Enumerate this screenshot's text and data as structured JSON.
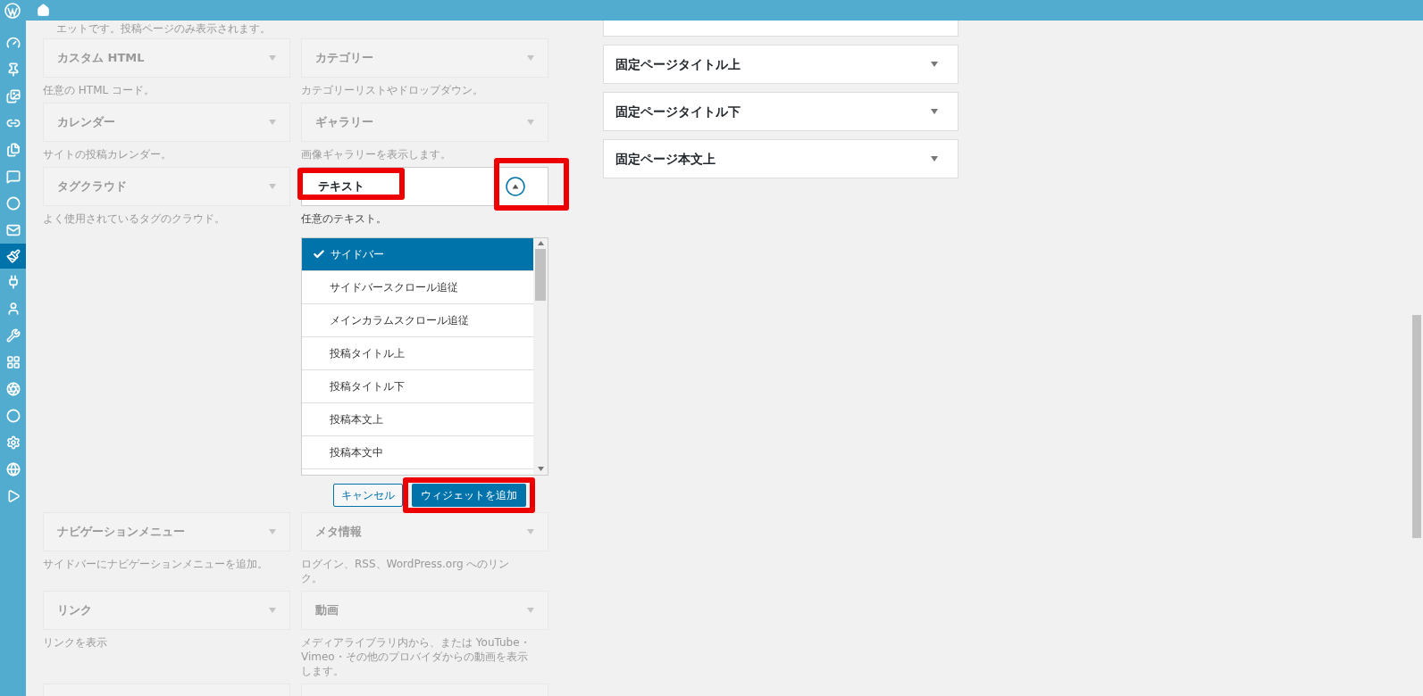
{
  "top_note": "エットです。投稿ページのみ表示されます。",
  "widgets": [
    {
      "title": "カスタム HTML",
      "description": "任意の HTML コード。",
      "dimmed": true,
      "expanded": false
    },
    {
      "title": "カテゴリー",
      "description": "カテゴリーリストやドロップダウン。",
      "dimmed": true,
      "expanded": false
    },
    {
      "title": "カレンダー",
      "description": "サイトの投稿カレンダー。",
      "dimmed": true,
      "expanded": false
    },
    {
      "title": "ギャラリー",
      "description": "画像ギャラリーを表示します。",
      "dimmed": true,
      "expanded": false
    },
    {
      "title": "タグクラウド",
      "description": "よく使用されているタグのクラウド。",
      "dimmed": true,
      "expanded": false
    },
    {
      "title": "テキスト",
      "description": "任意のテキスト。",
      "dimmed": false,
      "expanded": true
    },
    {
      "title": "ナビゲーションメニュー",
      "description": "サイドバーにナビゲーションメニューを追加。",
      "dimmed": true,
      "expanded": false
    },
    {
      "title": "メタ情報",
      "description": "ログイン、RSS、WordPress.org へのリンク。",
      "dimmed": true,
      "expanded": false
    },
    {
      "title": "リンク",
      "description": "リンクを表示",
      "dimmed": true,
      "expanded": false
    },
    {
      "title": "動画",
      "description": "メディアライブラリ内から、または YouTube・Vimeo・その他のプロバイダからの動画を表示します。",
      "dimmed": true,
      "expanded": false
    }
  ],
  "areas": [
    {
      "label": "サイドバー",
      "selected": true
    },
    {
      "label": "サイドバースクロール追従",
      "selected": false
    },
    {
      "label": "メインカラムスクロール追従",
      "selected": false
    },
    {
      "label": "投稿タイトル上",
      "selected": false
    },
    {
      "label": "投稿タイトル下",
      "selected": false
    },
    {
      "label": "投稿本文上",
      "selected": false
    },
    {
      "label": "投稿本文中",
      "selected": false
    }
  ],
  "buttons": {
    "cancel": "キャンセル",
    "add": "ウィジェットを追加"
  },
  "sidebar_areas": [
    {
      "title": "固定ページタイトル上",
      "expanded": false
    },
    {
      "title": "固定ページタイトル下",
      "expanded": false
    },
    {
      "title": "固定ページ本文上",
      "expanded": false
    }
  ]
}
